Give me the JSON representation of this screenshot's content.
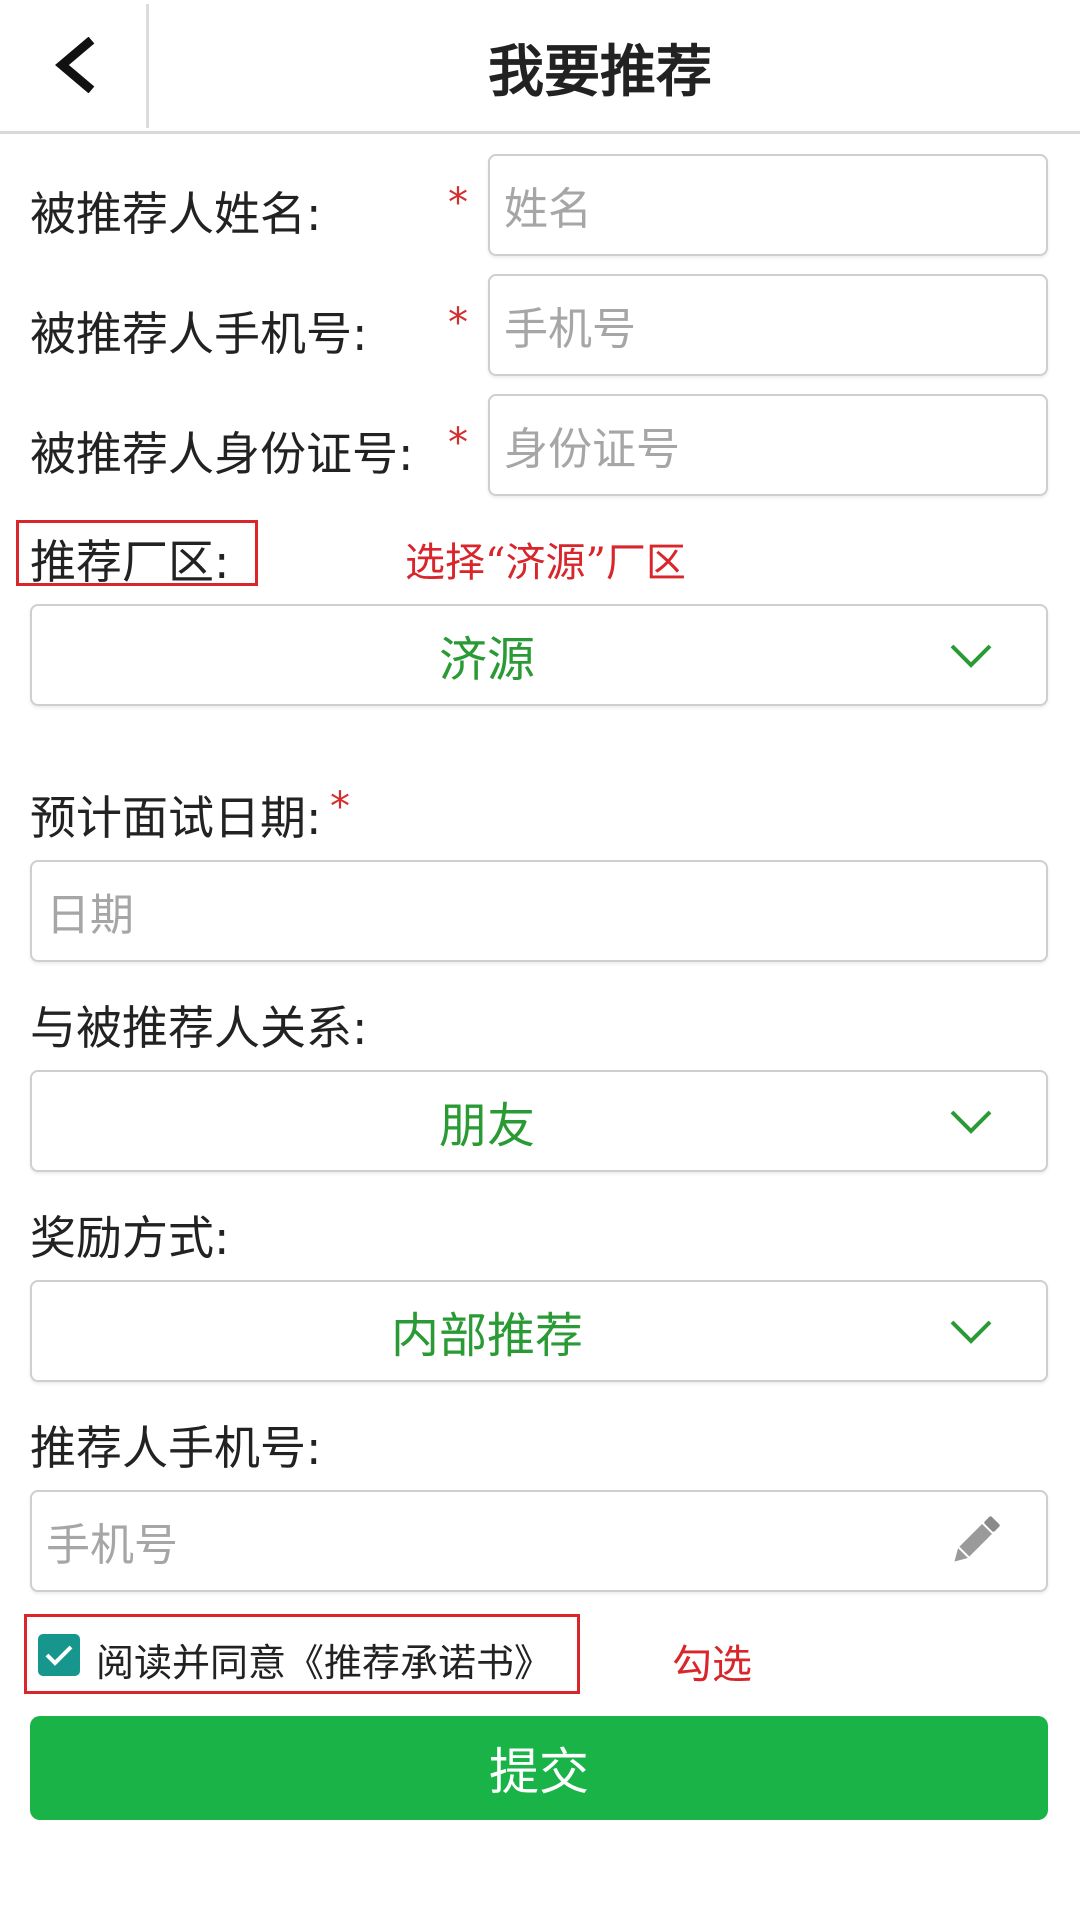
{
  "header": {
    "title": "我要推荐"
  },
  "form": {
    "name_label": "被推荐人姓名:",
    "name_placeholder": "姓名",
    "phone_label": "被推荐人手机号:",
    "phone_placeholder": "手机号",
    "id_label": "被推荐人身份证号:",
    "id_placeholder": "身份证号",
    "required_mark": "*",
    "factory_label": "推荐厂区:",
    "factory_value": "济源",
    "interview_label": "预计面试日期:",
    "interview_placeholder": "日期",
    "relation_label": "与被推荐人关系:",
    "relation_value": "朋友",
    "reward_label": "奖励方式:",
    "reward_value": "内部推荐",
    "referrer_phone_label": "推荐人手机号:",
    "referrer_phone_placeholder": "手机号",
    "agree_text": "阅读并同意《推荐承诺书》",
    "agree_checked": true,
    "submit_label": "提交"
  },
  "annotations": {
    "factory_note": "选择“济源”厂区",
    "agree_note": "勾选"
  },
  "icons": {
    "back": "chevron-left-icon",
    "dropdown": "chevron-down-icon",
    "edit": "pencil-icon",
    "check": "check-icon"
  },
  "colors": {
    "accent_green": "#19b347",
    "select_text_green": "#2a9a35",
    "annotation_red": "#d8262b",
    "required_red": "#d32f2f",
    "checkbox_teal": "#16968c"
  }
}
